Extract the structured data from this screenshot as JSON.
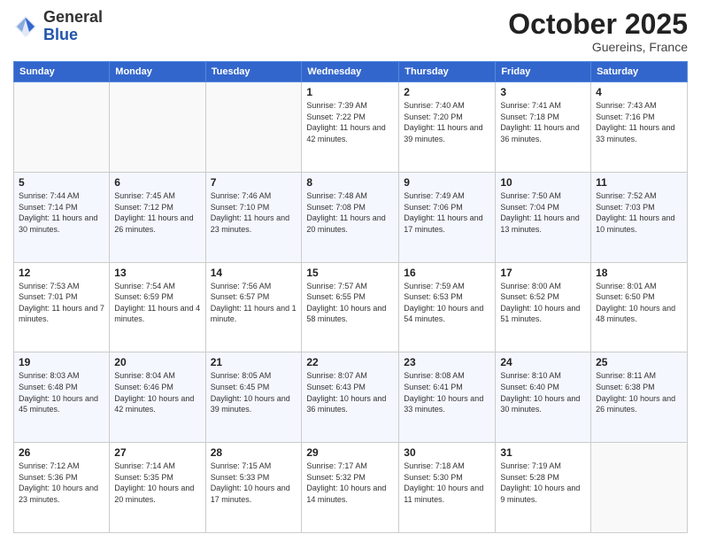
{
  "logo": {
    "general": "General",
    "blue": "Blue"
  },
  "header": {
    "month": "October 2025",
    "location": "Guereins, France"
  },
  "weekdays": [
    "Sunday",
    "Monday",
    "Tuesday",
    "Wednesday",
    "Thursday",
    "Friday",
    "Saturday"
  ],
  "weeks": [
    [
      {
        "day": "",
        "info": ""
      },
      {
        "day": "",
        "info": ""
      },
      {
        "day": "",
        "info": ""
      },
      {
        "day": "1",
        "info": "Sunrise: 7:39 AM\nSunset: 7:22 PM\nDaylight: 11 hours and 42 minutes."
      },
      {
        "day": "2",
        "info": "Sunrise: 7:40 AM\nSunset: 7:20 PM\nDaylight: 11 hours and 39 minutes."
      },
      {
        "day": "3",
        "info": "Sunrise: 7:41 AM\nSunset: 7:18 PM\nDaylight: 11 hours and 36 minutes."
      },
      {
        "day": "4",
        "info": "Sunrise: 7:43 AM\nSunset: 7:16 PM\nDaylight: 11 hours and 33 minutes."
      }
    ],
    [
      {
        "day": "5",
        "info": "Sunrise: 7:44 AM\nSunset: 7:14 PM\nDaylight: 11 hours and 30 minutes."
      },
      {
        "day": "6",
        "info": "Sunrise: 7:45 AM\nSunset: 7:12 PM\nDaylight: 11 hours and 26 minutes."
      },
      {
        "day": "7",
        "info": "Sunrise: 7:46 AM\nSunset: 7:10 PM\nDaylight: 11 hours and 23 minutes."
      },
      {
        "day": "8",
        "info": "Sunrise: 7:48 AM\nSunset: 7:08 PM\nDaylight: 11 hours and 20 minutes."
      },
      {
        "day": "9",
        "info": "Sunrise: 7:49 AM\nSunset: 7:06 PM\nDaylight: 11 hours and 17 minutes."
      },
      {
        "day": "10",
        "info": "Sunrise: 7:50 AM\nSunset: 7:04 PM\nDaylight: 11 hours and 13 minutes."
      },
      {
        "day": "11",
        "info": "Sunrise: 7:52 AM\nSunset: 7:03 PM\nDaylight: 11 hours and 10 minutes."
      }
    ],
    [
      {
        "day": "12",
        "info": "Sunrise: 7:53 AM\nSunset: 7:01 PM\nDaylight: 11 hours and 7 minutes."
      },
      {
        "day": "13",
        "info": "Sunrise: 7:54 AM\nSunset: 6:59 PM\nDaylight: 11 hours and 4 minutes."
      },
      {
        "day": "14",
        "info": "Sunrise: 7:56 AM\nSunset: 6:57 PM\nDaylight: 11 hours and 1 minute."
      },
      {
        "day": "15",
        "info": "Sunrise: 7:57 AM\nSunset: 6:55 PM\nDaylight: 10 hours and 58 minutes."
      },
      {
        "day": "16",
        "info": "Sunrise: 7:59 AM\nSunset: 6:53 PM\nDaylight: 10 hours and 54 minutes."
      },
      {
        "day": "17",
        "info": "Sunrise: 8:00 AM\nSunset: 6:52 PM\nDaylight: 10 hours and 51 minutes."
      },
      {
        "day": "18",
        "info": "Sunrise: 8:01 AM\nSunset: 6:50 PM\nDaylight: 10 hours and 48 minutes."
      }
    ],
    [
      {
        "day": "19",
        "info": "Sunrise: 8:03 AM\nSunset: 6:48 PM\nDaylight: 10 hours and 45 minutes."
      },
      {
        "day": "20",
        "info": "Sunrise: 8:04 AM\nSunset: 6:46 PM\nDaylight: 10 hours and 42 minutes."
      },
      {
        "day": "21",
        "info": "Sunrise: 8:05 AM\nSunset: 6:45 PM\nDaylight: 10 hours and 39 minutes."
      },
      {
        "day": "22",
        "info": "Sunrise: 8:07 AM\nSunset: 6:43 PM\nDaylight: 10 hours and 36 minutes."
      },
      {
        "day": "23",
        "info": "Sunrise: 8:08 AM\nSunset: 6:41 PM\nDaylight: 10 hours and 33 minutes."
      },
      {
        "day": "24",
        "info": "Sunrise: 8:10 AM\nSunset: 6:40 PM\nDaylight: 10 hours and 30 minutes."
      },
      {
        "day": "25",
        "info": "Sunrise: 8:11 AM\nSunset: 6:38 PM\nDaylight: 10 hours and 26 minutes."
      }
    ],
    [
      {
        "day": "26",
        "info": "Sunrise: 7:12 AM\nSunset: 5:36 PM\nDaylight: 10 hours and 23 minutes."
      },
      {
        "day": "27",
        "info": "Sunrise: 7:14 AM\nSunset: 5:35 PM\nDaylight: 10 hours and 20 minutes."
      },
      {
        "day": "28",
        "info": "Sunrise: 7:15 AM\nSunset: 5:33 PM\nDaylight: 10 hours and 17 minutes."
      },
      {
        "day": "29",
        "info": "Sunrise: 7:17 AM\nSunset: 5:32 PM\nDaylight: 10 hours and 14 minutes."
      },
      {
        "day": "30",
        "info": "Sunrise: 7:18 AM\nSunset: 5:30 PM\nDaylight: 10 hours and 11 minutes."
      },
      {
        "day": "31",
        "info": "Sunrise: 7:19 AM\nSunset: 5:28 PM\nDaylight: 10 hours and 9 minutes."
      },
      {
        "day": "",
        "info": ""
      }
    ]
  ]
}
